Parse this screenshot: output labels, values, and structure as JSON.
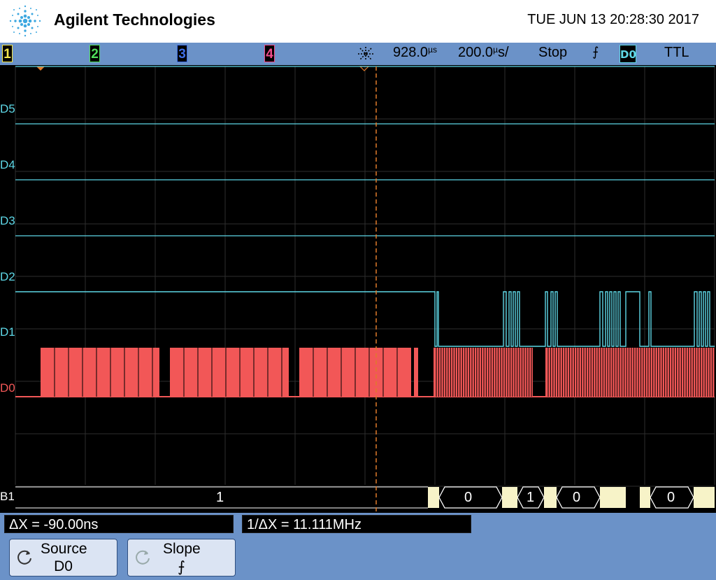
{
  "header": {
    "brand": "Agilent Technologies",
    "datetime": "TUE JUN 13 20:28:30 2017"
  },
  "status": {
    "channels": [
      {
        "label": "1",
        "color": "#f5e64a"
      },
      {
        "label": "2",
        "color": "#4fe05a"
      },
      {
        "label": "3",
        "color": "#3e6fe8"
      },
      {
        "label": "4",
        "color": "#f04b8a"
      }
    ],
    "trigger_delay": "928.0",
    "delay_unit": "µs",
    "timebase": "200.0",
    "timebase_unit": "s/",
    "timebase_prefix": "µ",
    "run_state": "Stop",
    "edge_symbol": "⨍",
    "trigger_source": "D0",
    "threshold": "TTL"
  },
  "channels": {
    "d5": "D5",
    "d4": "D4",
    "d3": "D3",
    "d2": "D2",
    "d1": "D1",
    "d0": "D0",
    "b1": "B1"
  },
  "bus_decode": {
    "values": [
      "1",
      "0",
      "1",
      "0",
      "0"
    ]
  },
  "measurements": {
    "delta_x": "ΔX = -90.00ns",
    "inv_delta_x": "1/ΔX = 11.111MHz"
  },
  "softkeys": {
    "source_label": "Source",
    "source_value": "D0",
    "slope_label": "Slope",
    "slope_value": "⨍"
  },
  "colors": {
    "digital": "#5ed7e6",
    "d0": "#f25757",
    "bus": "#f7f3c8",
    "cursor": "#e07a2a",
    "bar": "#6b92c8"
  }
}
